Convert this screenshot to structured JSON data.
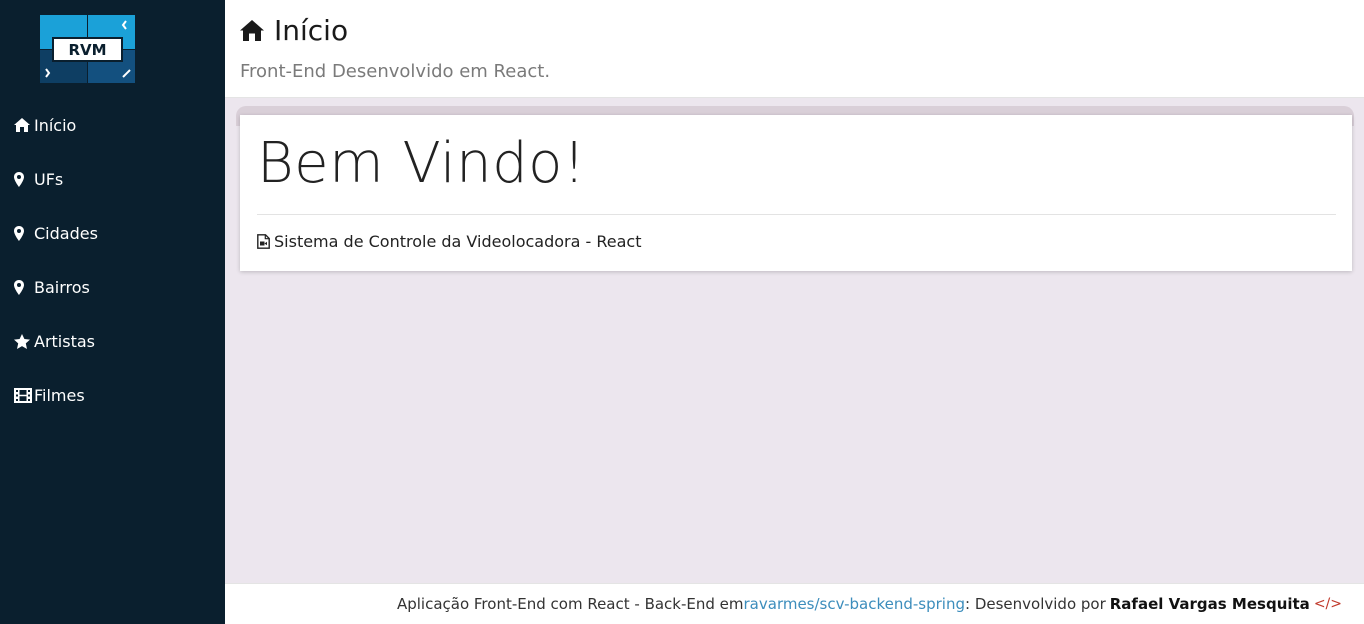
{
  "brand": {
    "logo_text": "RVM"
  },
  "sidebar": {
    "items": [
      {
        "label": "Início",
        "icon": "home-icon"
      },
      {
        "label": "UFs",
        "icon": "map-marker-icon"
      },
      {
        "label": "Cidades",
        "icon": "map-marker-icon"
      },
      {
        "label": "Bairros",
        "icon": "map-marker-icon"
      },
      {
        "label": "Artistas",
        "icon": "star-icon"
      },
      {
        "label": "Filmes",
        "icon": "film-icon"
      }
    ]
  },
  "header": {
    "title": "Início",
    "subtitle": "Front-End Desenvolvido em React."
  },
  "card": {
    "title": "Bem Vindo!",
    "text": "Sistema de Controle da Videolocadora - React"
  },
  "footer": {
    "prefix": "Aplicação Front-End com React - Back-End em ",
    "link_text": "ravarmes/scv-backend-spring",
    "middle": ": Desenvolvido por ",
    "author": "Rafael Vargas Mesquita",
    "code_glyph": "</>"
  },
  "colors": {
    "sidebar_bg": "#0a1f2e",
    "content_bg": "#ece6ee",
    "link": "#3c8dbc",
    "code_icon": "#c0392b",
    "logo_blue": "#1ba1d8",
    "logo_dark": "#13507f"
  }
}
